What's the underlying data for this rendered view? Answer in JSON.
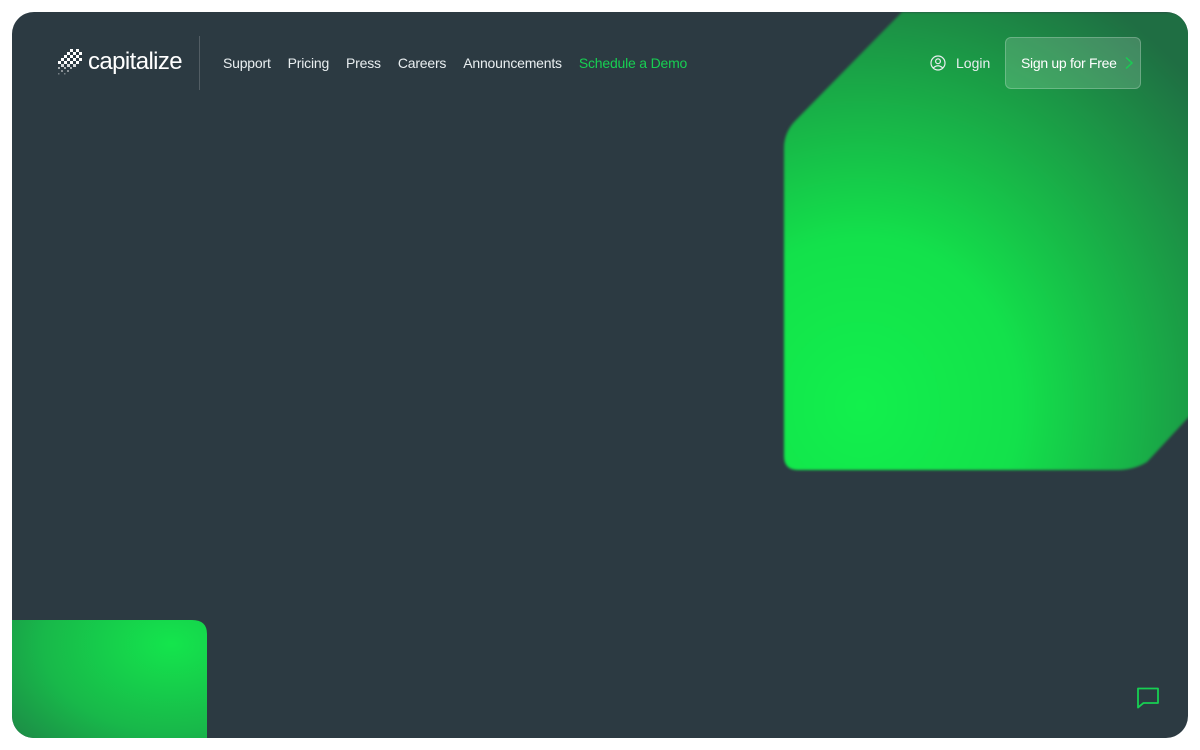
{
  "brand": {
    "name": "capitalize",
    "logo_icon": "checker-logo-icon"
  },
  "nav": {
    "links": [
      {
        "label": "Support"
      },
      {
        "label": "Pricing"
      },
      {
        "label": "Press"
      },
      {
        "label": "Careers"
      },
      {
        "label": "Announcements"
      },
      {
        "label": "Schedule a Demo",
        "accent": true
      }
    ]
  },
  "auth": {
    "login_label": "Login",
    "login_icon": "user-circle-icon",
    "signup_label": "Sign up for Free",
    "signup_icon": "chevron-right-icon"
  },
  "chat": {
    "icon": "chat-bubble-icon"
  },
  "colors": {
    "background": "#2c3a42",
    "accent": "#17cf52",
    "shape_green_bright": "#12f04c",
    "shape_green_dark": "#1f7a45"
  }
}
